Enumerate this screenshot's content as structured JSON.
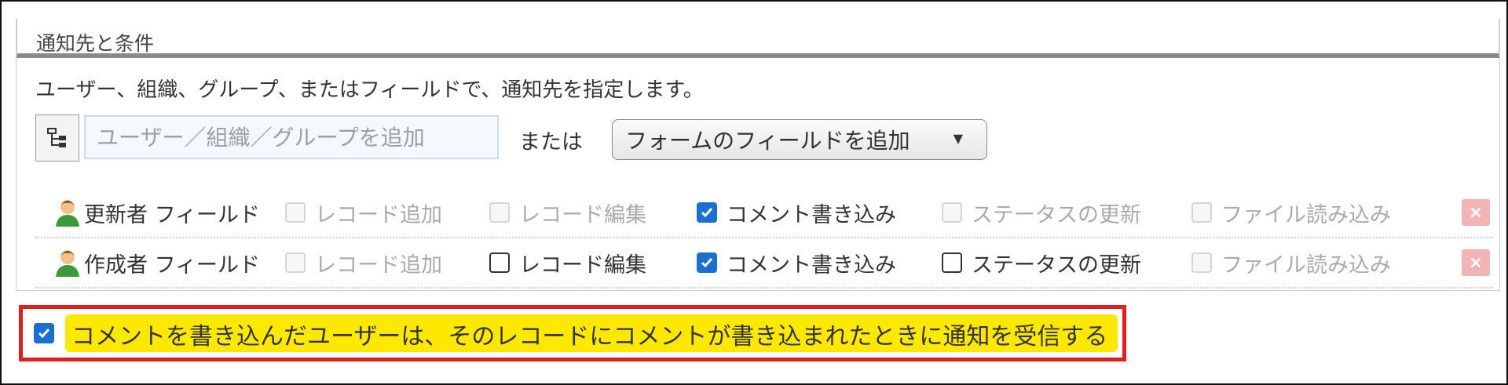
{
  "section": {
    "title": "通知先と条件",
    "description": "ユーザー、組織、グループ、またはフィールドで、通知先を指定します。"
  },
  "recipient_picker": {
    "org_tree_icon": "org-tree-icon",
    "input_placeholder": "ユーザー／組織／グループを追加",
    "or_label": "または",
    "field_select_label": "フォームのフィールドを追加",
    "field_select_caret": "▼"
  },
  "recipients": [
    {
      "name": "更新者 フィールド",
      "icon": "user-avatar-icon",
      "options": [
        {
          "label": "レコード追加",
          "checked": false,
          "disabled": true
        },
        {
          "label": "レコード編集",
          "checked": false,
          "disabled": true
        },
        {
          "label": "コメント書き込み",
          "checked": true,
          "disabled": false
        },
        {
          "label": "ステータスの更新",
          "checked": false,
          "disabled": true
        },
        {
          "label": "ファイル読み込み",
          "checked": false,
          "disabled": true
        }
      ],
      "delete_icon": "×"
    },
    {
      "name": "作成者 フィールド",
      "icon": "user-avatar-icon",
      "options": [
        {
          "label": "レコード追加",
          "checked": false,
          "disabled": true
        },
        {
          "label": "レコード編集",
          "checked": false,
          "disabled": false
        },
        {
          "label": "コメント書き込み",
          "checked": true,
          "disabled": false
        },
        {
          "label": "ステータスの更新",
          "checked": false,
          "disabled": false
        },
        {
          "label": "ファイル読み込み",
          "checked": false,
          "disabled": true
        }
      ],
      "delete_icon": "×"
    }
  ],
  "comment_notice": {
    "checked": true,
    "label": "コメントを書き込んだユーザーは、そのレコードにコメントが書き込まれたときに通知を受信する"
  },
  "colors": {
    "checkbox_checked": "#1a6fd1",
    "highlight": "#ffe800",
    "annotation_border": "#e01e1e",
    "delete_button": "#f2b5b5"
  }
}
